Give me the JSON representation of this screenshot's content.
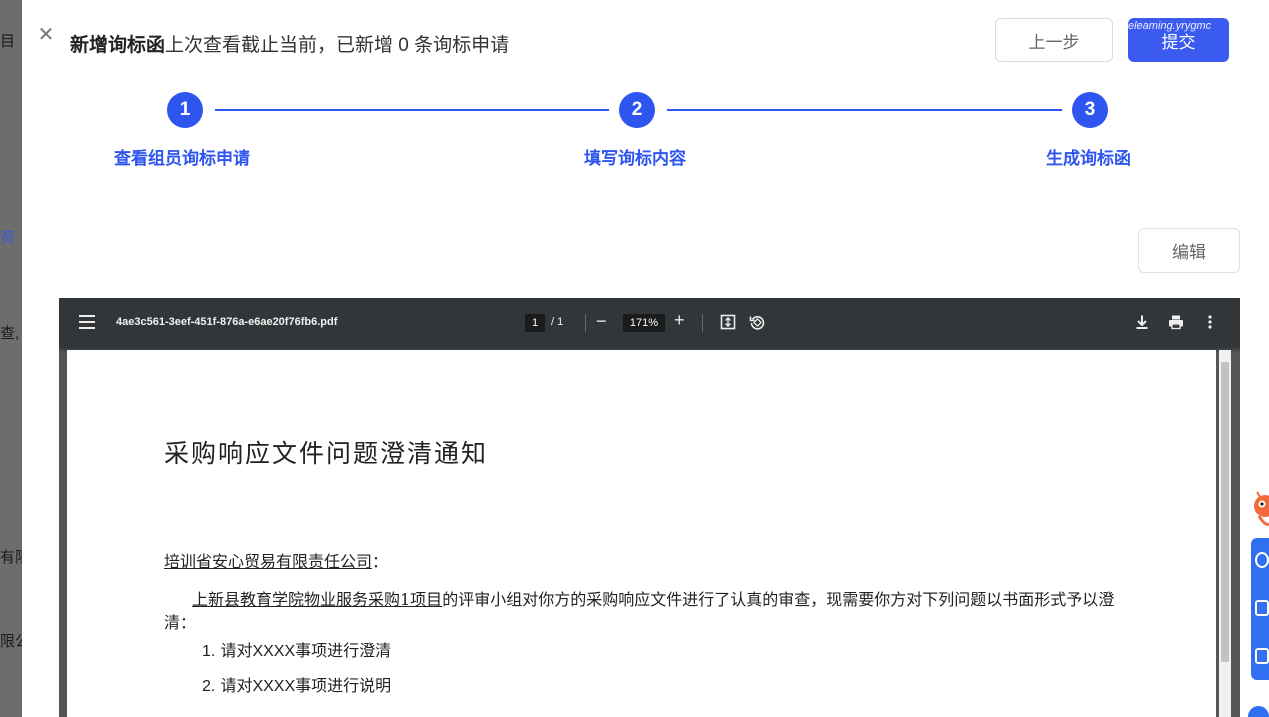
{
  "background_fragments": [
    "目",
    "资",
    "查,",
    "有限",
    "限公"
  ],
  "header": {
    "title_strong": "新增询标函",
    "title_rest": "上次查看截止当前，已新增 0 条询标申请",
    "prev_label": "上一步",
    "submit_label": "提交",
    "watermark": "eleaming.yrygmc"
  },
  "steps": [
    {
      "number": "1",
      "label": "查看组员询标申请"
    },
    {
      "number": "2",
      "label": "填写询标内容"
    },
    {
      "number": "3",
      "label": "生成询标函"
    }
  ],
  "edit_label": "编辑",
  "pdf": {
    "filename": "4ae3c561-3eef-451f-876a-e6ae20f76fb6.pdf",
    "current_page": "1",
    "total_pages": "/ 1",
    "zoom": "171%",
    "icons": [
      "menu-icon",
      "fit-page-icon",
      "rotate-icon",
      "download-icon",
      "print-icon",
      "more-icon"
    ]
  },
  "document": {
    "title": "采购响应文件问题澄清通知",
    "recipient": "培训省安心贸易有限责任公司",
    "recipient_suffix": "：",
    "project": "上新县教育学院物业服务采购1项目",
    "body_rest": "的评审小组对你方的采购响应文件进行了认真的审查，现需要你方对下列问题以书面形式予以澄清：",
    "items": [
      {
        "num": "1.",
        "pre": "请对",
        "code": "XXXX",
        "post": "事项进行澄清"
      },
      {
        "num": "2.",
        "pre": "请对",
        "code": "XXXX",
        "post": "事项进行说明"
      }
    ]
  },
  "colors": {
    "accent": "#2f55f0",
    "submit": "#3b5bf0",
    "pdf_toolbar": "#323639",
    "pdf_background": "#525659"
  }
}
